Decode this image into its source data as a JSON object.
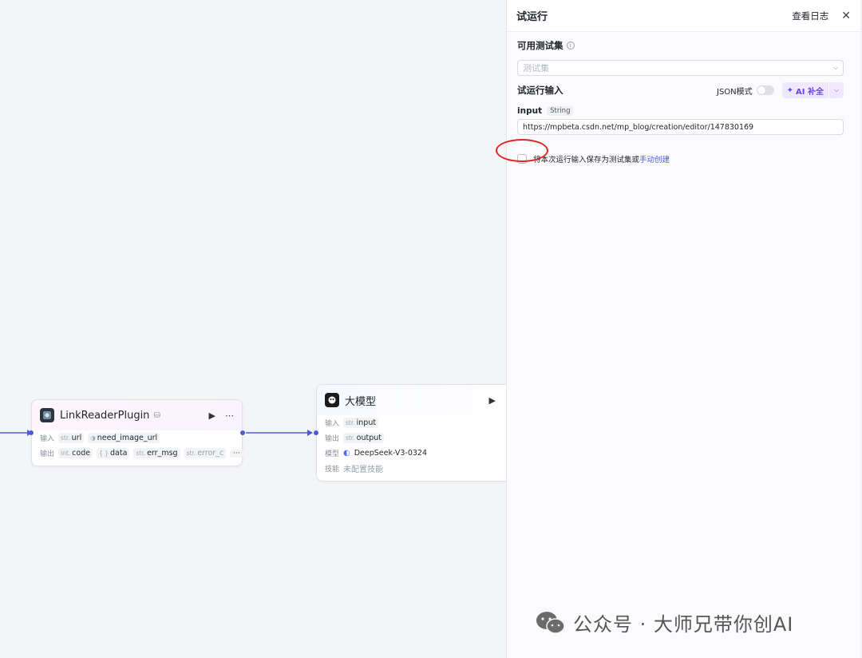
{
  "canvas": {
    "node1": {
      "title": "LinkReaderPlugin",
      "input_label": "输入",
      "output_label": "输出",
      "inputs": [
        {
          "type": "str.",
          "name": "url"
        },
        {
          "type": "◑",
          "name": "need_image_url"
        }
      ],
      "outputs": [
        {
          "type": "int.",
          "name": "code"
        },
        {
          "type": "{ }",
          "name": "data"
        },
        {
          "type": "str.",
          "name": "err_msg"
        },
        {
          "type": "str.",
          "name": "error_c"
        }
      ],
      "more": "···"
    },
    "node2": {
      "title": "大模型",
      "input_label": "输入",
      "output_label": "输出",
      "model_label": "模型",
      "skill_label": "技能",
      "inputs": [
        {
          "type": "str.",
          "name": "input"
        }
      ],
      "outputs": [
        {
          "type": "str.",
          "name": "output"
        }
      ],
      "model_value": "DeepSeek-V3-0324",
      "skill_value": "未配置技能"
    }
  },
  "panel": {
    "title": "试运行",
    "log_link": "查看日志",
    "test_set_label": "可用测试集",
    "test_set_placeholder": "测试集",
    "run_input_label": "试运行输入",
    "json_mode_label": "JSON模式",
    "ai_button_label": "AI 补全",
    "field_name": "input",
    "field_type": "String",
    "field_value": "https://mpbeta.csdn.net/mp_blog/creation/editor/147830169",
    "save_text": "将本次运行输入保存为测试集或",
    "save_link": "手动创建"
  },
  "watermark": {
    "text": "公众号 · 大师兄带你创AI"
  },
  "colors": {
    "accent": "#4e5bd6",
    "ai_purple": "#6f42e8",
    "annotation_red": "#e02424"
  }
}
